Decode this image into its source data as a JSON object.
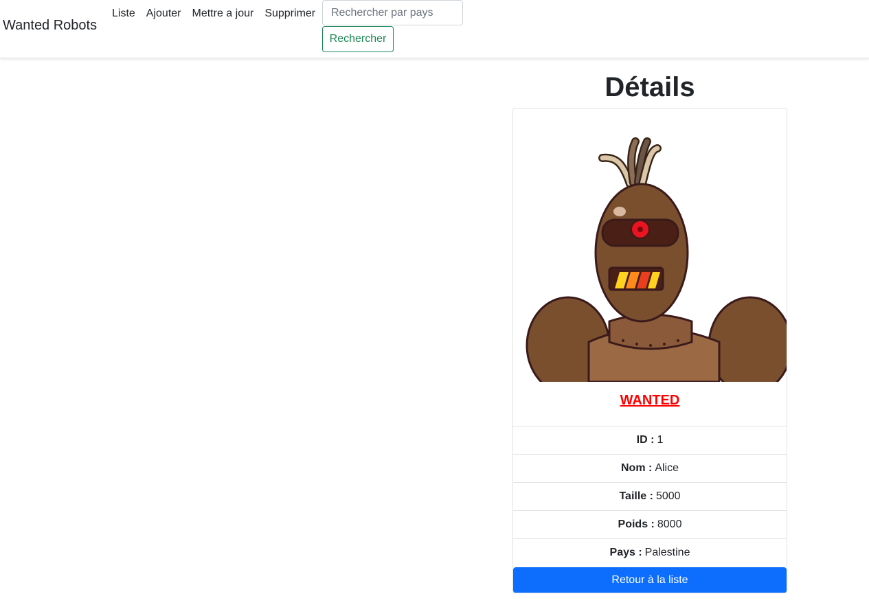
{
  "navbar": {
    "brand": "Wanted Robots",
    "links": [
      "Liste",
      "Ajouter",
      "Mettre a jour",
      "Supprimer"
    ],
    "search_placeholder": "Rechercher par pays",
    "search_button": "Rechercher"
  },
  "details": {
    "title": "Détails",
    "wanted": "WANTED",
    "fields": [
      {
        "label": "ID :",
        "value": "1"
      },
      {
        "label": "Nom :",
        "value": "Alice"
      },
      {
        "label": "Taille :",
        "value": "5000"
      },
      {
        "label": "Poids :",
        "value": "8000"
      },
      {
        "label": "Pays :",
        "value": "Palestine"
      }
    ],
    "back_button": "Retour à la liste"
  },
  "colors": {
    "primary": "#0d6efd",
    "success": "#198754",
    "wanted": "#ff0000",
    "robot_body": "#7a4f2e",
    "robot_eye": "#e8141f"
  }
}
